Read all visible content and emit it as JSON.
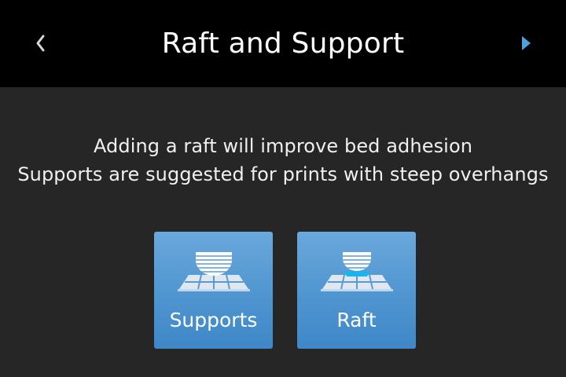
{
  "header": {
    "title": "Raft and Support",
    "back_icon": "chevron-left-icon",
    "next_icon": "play-right-icon",
    "next_color": "#4aa3df"
  },
  "description": {
    "line1": "Adding a raft will improve bed adhesion",
    "line2": "Supports are suggested for prints with steep overhangs"
  },
  "options": [
    {
      "label": "Supports",
      "icon": "supports-icon"
    },
    {
      "label": "Raft",
      "icon": "raft-icon"
    }
  ],
  "colors": {
    "background": "#262626",
    "header_background": "#000000",
    "button_blue": "#4f95d0",
    "accent_cyan": "#19b4ec"
  }
}
